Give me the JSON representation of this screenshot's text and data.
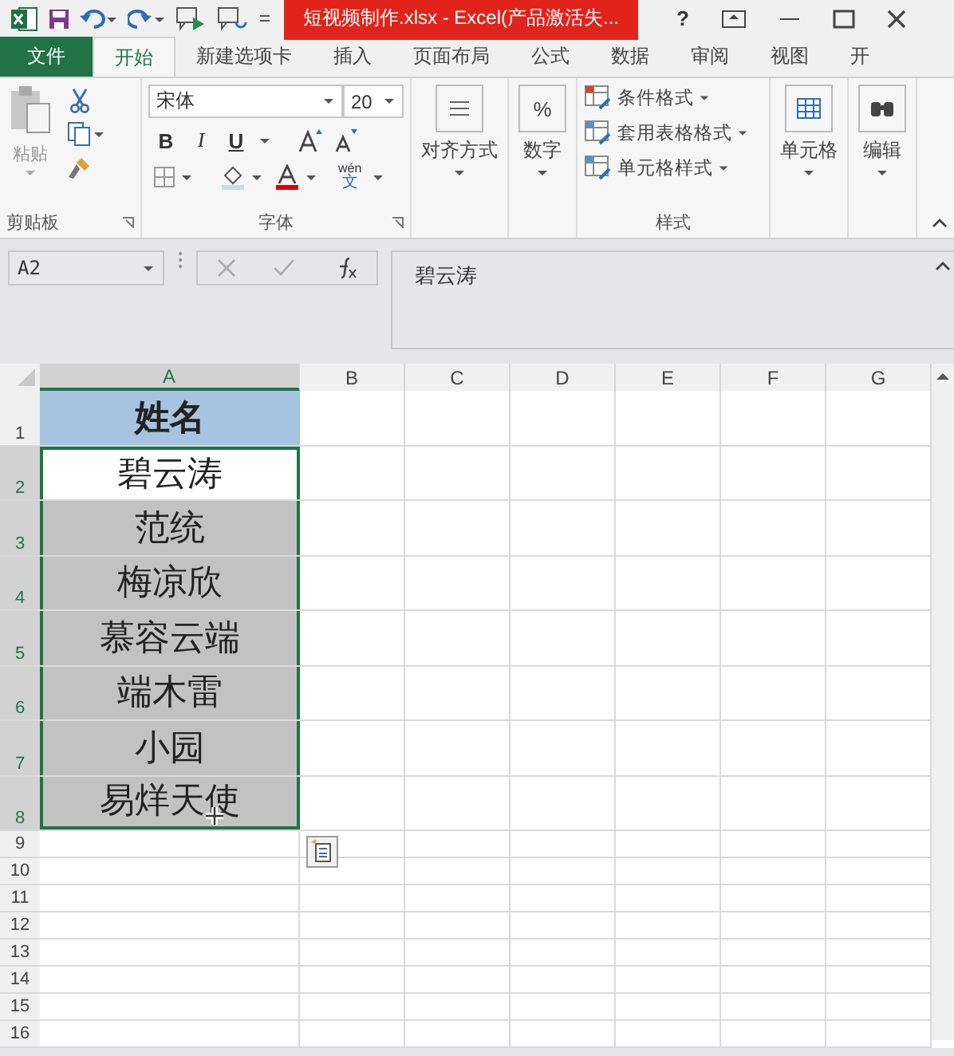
{
  "title_bar": {
    "title": "短视频制作.xlsx -  Excel(产品激活失...",
    "help": "?"
  },
  "tabs": [
    {
      "label": "文件",
      "kind": "file",
      "selected": false
    },
    {
      "label": "开始",
      "kind": "tab",
      "selected": true
    },
    {
      "label": "新建选项卡",
      "kind": "tab",
      "selected": false
    },
    {
      "label": "插入",
      "kind": "tab",
      "selected": false
    },
    {
      "label": "页面布局",
      "kind": "tab",
      "selected": false
    },
    {
      "label": "公式",
      "kind": "tab",
      "selected": false
    },
    {
      "label": "数据",
      "kind": "tab",
      "selected": false
    },
    {
      "label": "审阅",
      "kind": "tab",
      "selected": false
    },
    {
      "label": "视图",
      "kind": "tab",
      "selected": false
    },
    {
      "label": "开",
      "kind": "tab",
      "selected": false
    }
  ],
  "ribbon": {
    "clipboard": {
      "paste": "粘贴",
      "label": "剪贴板"
    },
    "font": {
      "name": "宋体",
      "size": "20",
      "bold": "B",
      "italic": "I",
      "underline": "U",
      "phonetic_top": "wén",
      "phonetic_bottom": "文",
      "label": "字体"
    },
    "alignment": "对齐方式",
    "number": {
      "icon": "%",
      "label": "数字"
    },
    "styles": {
      "items": [
        "条件格式",
        "套用表格格式",
        "单元格样式"
      ],
      "label": "样式"
    },
    "cells": "单元格",
    "editing": "编辑"
  },
  "formula_bar": {
    "name_box": "A2",
    "content": "碧云涛"
  },
  "columns": [
    {
      "label": "A",
      "selected": true
    },
    {
      "label": "B",
      "selected": false
    },
    {
      "label": "C",
      "selected": false
    },
    {
      "label": "D",
      "selected": false
    },
    {
      "label": "E",
      "selected": false
    },
    {
      "label": "F",
      "selected": false
    },
    {
      "label": "G",
      "selected": false
    }
  ],
  "rows": [
    {
      "number": "1",
      "kind": "tall",
      "selected": false,
      "cell": {
        "text": "姓名",
        "kind": "header",
        "selected": false,
        "active": false
      }
    },
    {
      "number": "2",
      "kind": "tall",
      "selected": true,
      "cell": {
        "text": "碧云涛",
        "kind": "data",
        "selected": true,
        "active": true
      }
    },
    {
      "number": "3",
      "kind": "tall",
      "selected": true,
      "cell": {
        "text": "范统",
        "kind": "data",
        "selected": true,
        "active": false
      }
    },
    {
      "number": "4",
      "kind": "tall",
      "selected": true,
      "cell": {
        "text": "梅凉欣",
        "kind": "data",
        "selected": true,
        "active": false
      }
    },
    {
      "number": "5",
      "kind": "tall",
      "selected": true,
      "cell": {
        "text": "慕容云端",
        "kind": "data",
        "selected": true,
        "active": false
      }
    },
    {
      "number": "6",
      "kind": "tall",
      "selected": true,
      "cell": {
        "text": "端木雷",
        "kind": "data",
        "selected": true,
        "active": false
      }
    },
    {
      "number": "7",
      "kind": "tall",
      "selected": true,
      "cell": {
        "text": "小园",
        "kind": "data",
        "selected": true,
        "active": false
      }
    },
    {
      "number": "8",
      "kind": "tall",
      "selected": true,
      "cell": {
        "text": "易烊天使",
        "kind": "data",
        "selected": true,
        "active": false
      }
    },
    {
      "number": "9",
      "kind": "short",
      "selected": false
    },
    {
      "number": "10",
      "kind": "short",
      "selected": false
    },
    {
      "number": "11",
      "kind": "short",
      "selected": false
    },
    {
      "number": "12",
      "kind": "short",
      "selected": false
    },
    {
      "number": "13",
      "kind": "short",
      "selected": false
    },
    {
      "number": "14",
      "kind": "short",
      "selected": false
    },
    {
      "number": "15",
      "kind": "short",
      "selected": false
    },
    {
      "number": "16",
      "kind": "short",
      "selected": false
    }
  ]
}
